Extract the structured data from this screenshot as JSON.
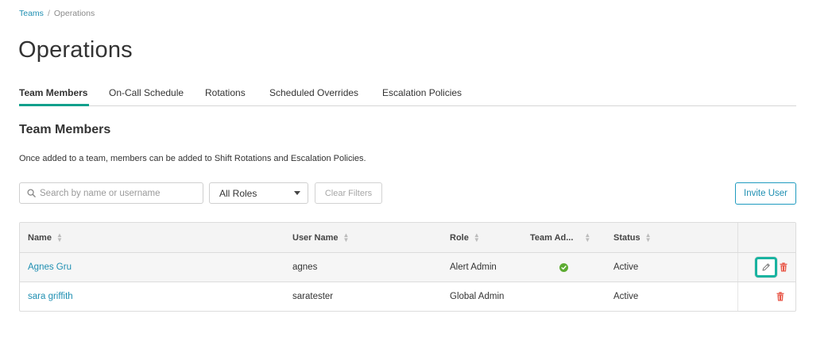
{
  "breadcrumb": {
    "parent": "Teams",
    "separator": "/",
    "current": "Operations"
  },
  "page_title": "Operations",
  "tabs": [
    {
      "label": "Team Members",
      "active": true
    },
    {
      "label": "On-Call Schedule",
      "active": false
    },
    {
      "label": "Rotations",
      "active": false
    },
    {
      "label": "Scheduled Overrides",
      "active": false
    },
    {
      "label": "Escalation Policies",
      "active": false
    }
  ],
  "section": {
    "title": "Team Members",
    "description": "Once added to a team, members can be added to Shift Rotations and Escalation Policies."
  },
  "filters": {
    "search_placeholder": "Search by name or username",
    "search_value": "",
    "role_selected": "All Roles",
    "clear_label": "Clear Filters"
  },
  "invite_label": "Invite User",
  "table": {
    "headers": [
      "Name",
      "User Name",
      "Role",
      "Team Ad...",
      "Status"
    ],
    "rows": [
      {
        "name": "Agnes Gru",
        "username": "agnes",
        "role": "Alert Admin",
        "team_admin": true,
        "status": "Active"
      },
      {
        "name": "sara griffith",
        "username": "saratester",
        "role": "Global Admin",
        "team_admin": false,
        "status": "Active"
      }
    ]
  },
  "colors": {
    "accent_teal": "#12a08c",
    "link_blue": "#1f8fb2",
    "check_green": "#5dab32",
    "trash_red": "#e8594a",
    "highlight_teal": "#19b3a0"
  },
  "icons": [
    "search-icon",
    "chevron-down-icon",
    "sort-icon",
    "check-circle-icon",
    "pencil-icon",
    "trash-icon"
  ]
}
